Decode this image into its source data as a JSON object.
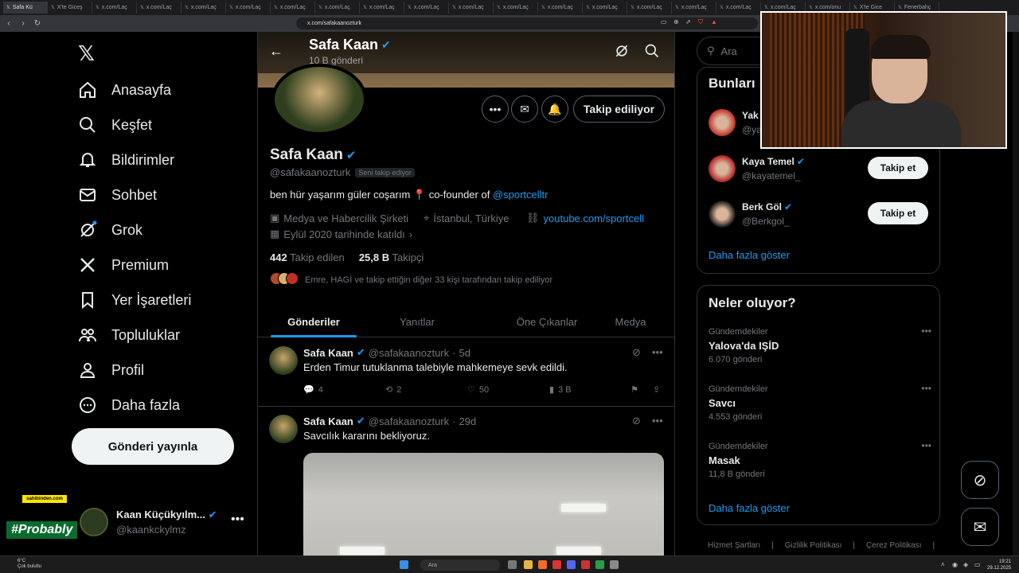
{
  "browser": {
    "tabs": [
      "Safa Kü",
      "X'te Giceş",
      "x.com/Laç",
      "x.com/Laç",
      "x.com/Laç",
      "x.com/Laç",
      "x.com/Laç",
      "x.com/Laç",
      "x.com/Laç",
      "x.com/Laç",
      "x.com/Laç",
      "x.com/Laç",
      "x.com/Laç",
      "x.com/Laç",
      "x.com/Laç",
      "x.com/Laç",
      "x.com/Laç",
      "x.com/Laç",
      "x.com/onu",
      "X'te Gice",
      "Fenerbahç"
    ],
    "url": "x.com/safakaanozturk"
  },
  "nav": {
    "items": [
      {
        "label": "Anasayfa",
        "icon": "home-icon"
      },
      {
        "label": "Keşfet",
        "icon": "search-icon"
      },
      {
        "label": "Bildirimler",
        "icon": "bell-icon"
      },
      {
        "label": "Sohbet",
        "icon": "mail-icon"
      },
      {
        "label": "Grok",
        "icon": "grok-icon"
      },
      {
        "label": "Premium",
        "icon": "x-logo-icon"
      },
      {
        "label": "Yer İşaretleri",
        "icon": "bookmark-icon"
      },
      {
        "label": "Topluluklar",
        "icon": "people-icon"
      },
      {
        "label": "Profil",
        "icon": "user-icon"
      },
      {
        "label": "Daha fazla",
        "icon": "more-circle-icon"
      }
    ],
    "post_button": "Gönderi yayınla",
    "account": {
      "name": "Kaan Küçükyılm...",
      "handle": "@kaankckylmz"
    }
  },
  "overlay": {
    "sahibinden": "sahibinden.com",
    "probably": "#Probably"
  },
  "profile": {
    "header_name": "Safa Kaan",
    "header_count": "10 B gönderi",
    "name": "Safa Kaan",
    "handle": "@safakaanozturk",
    "follows_you": "Seni takip ediyor",
    "bio_text": "ben hür yaşarım güler coşarım 📍 co-founder of",
    "bio_link": "@sportcelltr",
    "category": "Medya ve Habercilik Şirketi",
    "location": "İstanbul, Türkiye",
    "website": "youtube.com/sportcell",
    "joined": "Eylül 2020 tarihinde katıldı",
    "following_count": "442",
    "following_label": "Takip edilen",
    "followers_count": "25,8 B",
    "followers_label": "Takipçi",
    "followed_by": "Emre, HAGİ ve takip ettiğin diğer 33 kişi tarafından takip ediliyor",
    "follow_button": "Takip ediliyor"
  },
  "tabs": [
    {
      "label": "Gönderiler",
      "active": true
    },
    {
      "label": "Yanıtlar",
      "active": false
    },
    {
      "label": "Öne Çıkanlar",
      "active": false
    },
    {
      "label": "Medya",
      "active": false
    }
  ],
  "tweets": [
    {
      "name": "Safa Kaan",
      "handle": "@safakaanozturk",
      "time": "5d",
      "text": "Erden Timur tutuklanma talebiyle mahkemeye sevk edildi.",
      "replies": "4",
      "reposts": "2",
      "likes": "50",
      "views": "3 B"
    },
    {
      "name": "Safa Kaan",
      "handle": "@safakaanozturk",
      "time": "29d",
      "text": "Savcılık kararını bekliyoruz."
    }
  ],
  "right": {
    "search_placeholder": "Ara",
    "who_title": "Bunları",
    "who": [
      {
        "name": "Yak",
        "handle": "@ya",
        "button": ""
      },
      {
        "name": "Kaya Temel",
        "handle": "@kayatemel_",
        "button": "Takip et"
      },
      {
        "name": "Berk Göl",
        "handle": "@Berkgol_",
        "button": "Takip et"
      }
    ],
    "who_more": "Daha fazla göster",
    "trends_title": "Neler oluyor?",
    "trends": [
      {
        "category": "Gündemdekiler",
        "title": "Yalova'da IŞİD",
        "count": "6.070 gönderi"
      },
      {
        "category": "Gündemdekiler",
        "title": "Savcı",
        "count": "4.553 gönderi"
      },
      {
        "category": "Gündemdekiler",
        "title": "Masak",
        "count": "11,8 B gönderi"
      }
    ],
    "trends_more": "Daha fazla göster",
    "footer": [
      "Hizmet Şartları",
      "Gizlilik Politikası",
      "Çerez Politikası"
    ]
  },
  "taskbar": {
    "weather_temp": "6°C",
    "weather_desc": "Çok bulutlu",
    "search": "Ara",
    "time": "19:21",
    "date": "29.12.2025"
  },
  "colors": {
    "accent": "#1d9bf0",
    "background": "#000000",
    "text": "#e7e9ea",
    "muted": "#71767b"
  }
}
